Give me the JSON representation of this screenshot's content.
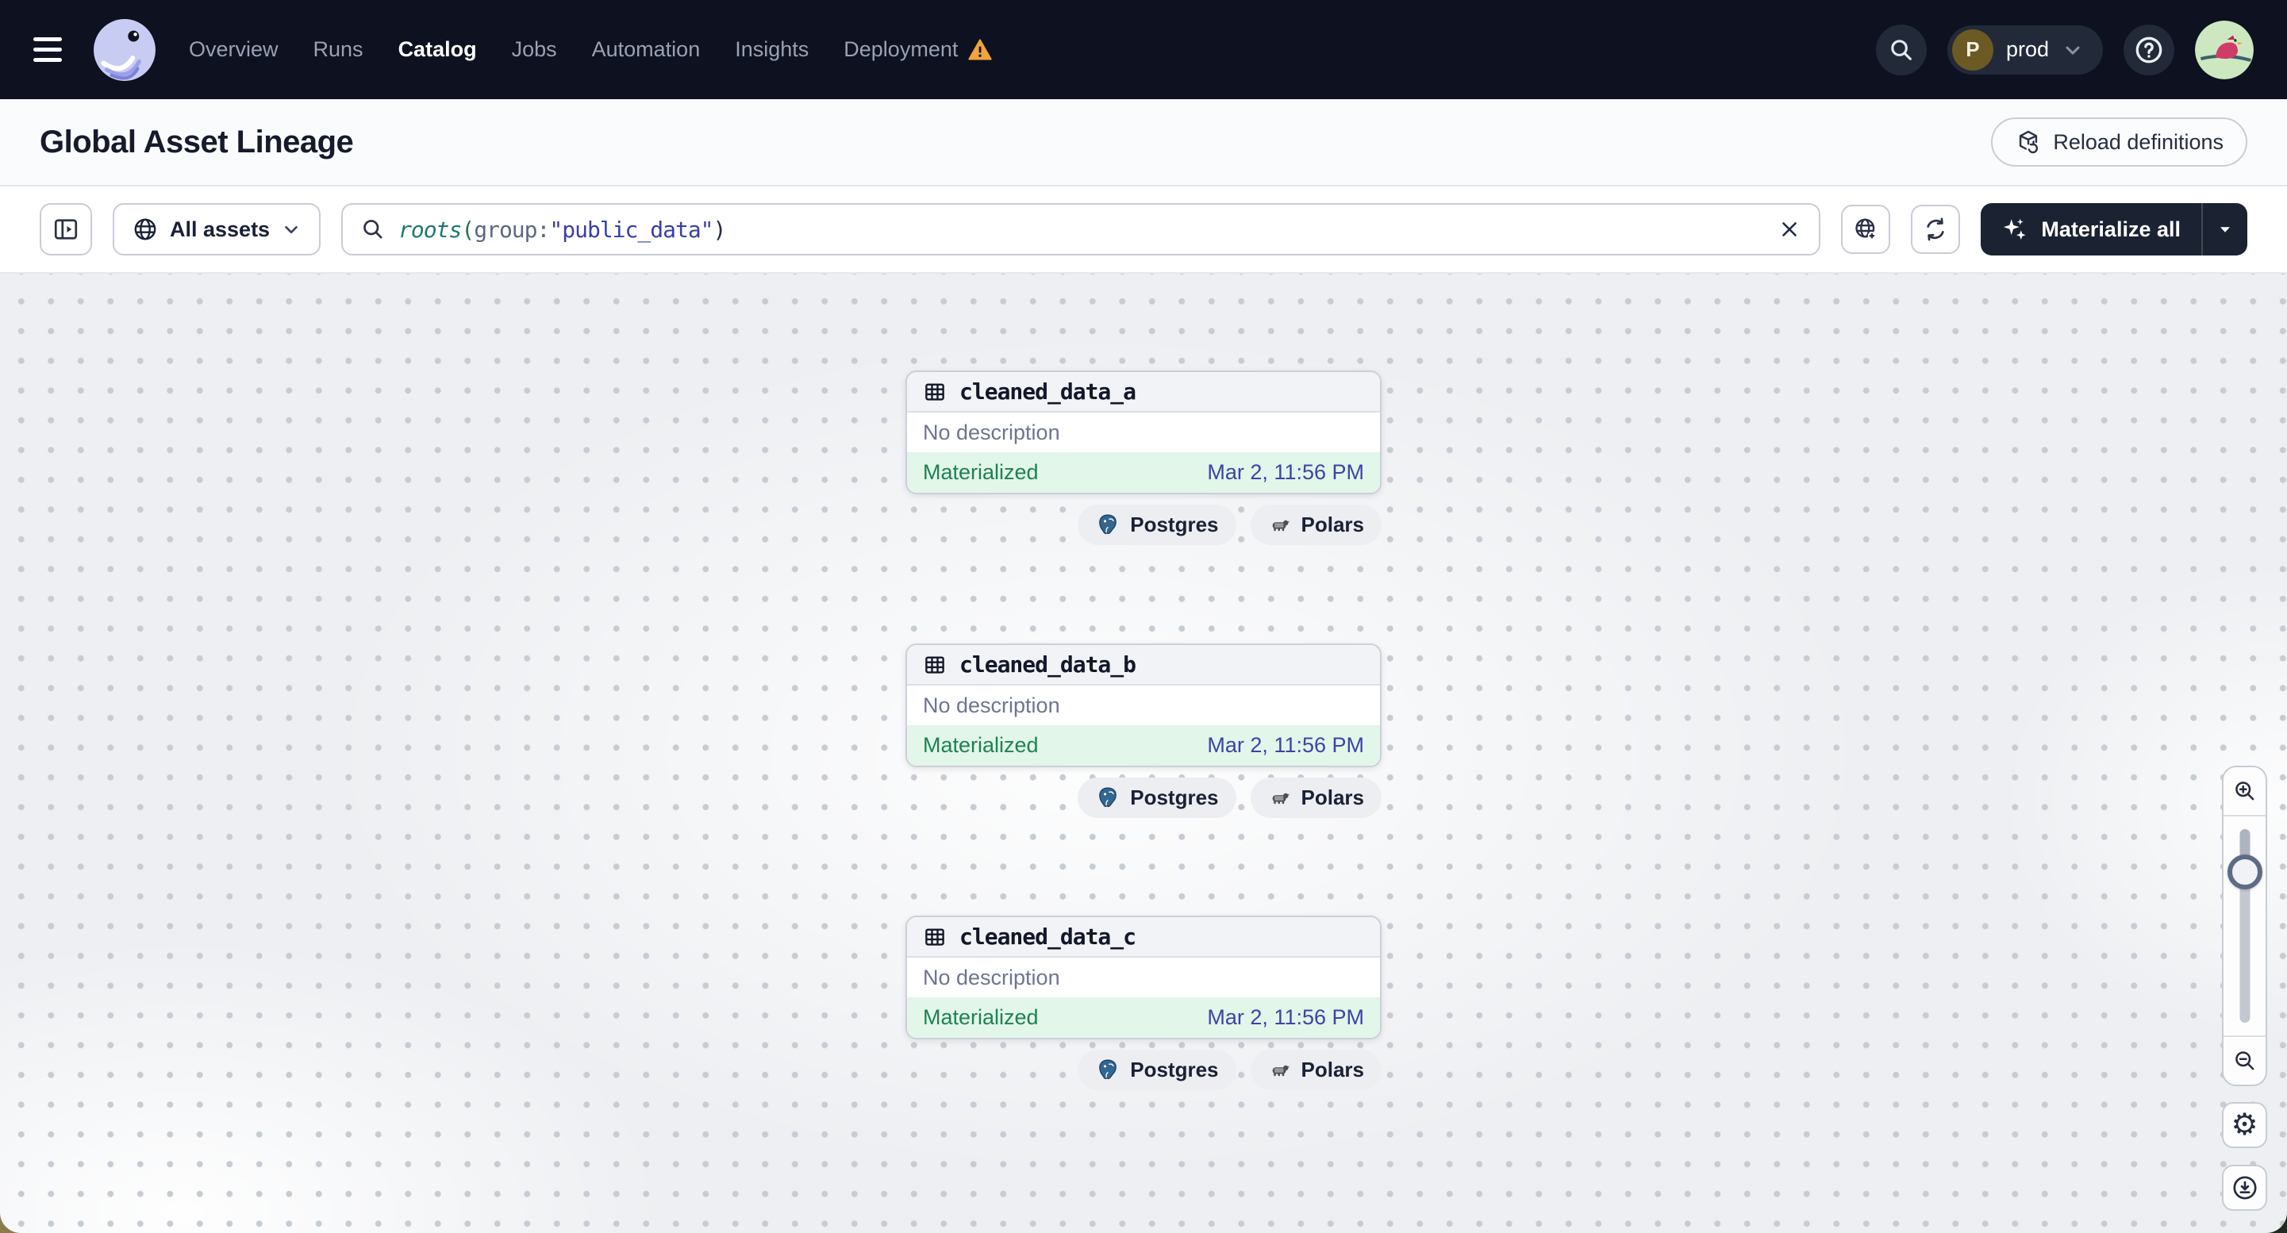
{
  "nav": {
    "items": [
      {
        "label": "Overview"
      },
      {
        "label": "Runs"
      },
      {
        "label": "Catalog"
      },
      {
        "label": "Jobs"
      },
      {
        "label": "Automation"
      },
      {
        "label": "Insights"
      },
      {
        "label": "Deployment"
      }
    ],
    "active_item": "Catalog",
    "workspace": {
      "initial": "P",
      "label": "prod"
    }
  },
  "header": {
    "title": "Global Asset Lineage",
    "reload_label": "Reload definitions"
  },
  "toolbar": {
    "scope_label": "All assets",
    "search_query": {
      "func": "roots",
      "open_paren": "(",
      "key": "group",
      "colon": ":",
      "value": "\"public_data\"",
      "close_paren": ")"
    },
    "materialize_label": "Materialize all"
  },
  "canvas": {
    "assets": [
      {
        "name": "cleaned_data_a",
        "description": "No description",
        "status": "Materialized",
        "timestamp": "Mar 2, 11:56 PM",
        "tags": [
          "Postgres",
          "Polars"
        ]
      },
      {
        "name": "cleaned_data_b",
        "description": "No description",
        "status": "Materialized",
        "timestamp": "Mar 2, 11:56 PM",
        "tags": [
          "Postgres",
          "Polars"
        ]
      },
      {
        "name": "cleaned_data_c",
        "description": "No description",
        "status": "Materialized",
        "timestamp": "Mar 2, 11:56 PM",
        "tags": [
          "Postgres",
          "Polars"
        ]
      }
    ]
  },
  "colors": {
    "nav_bg": "#0d1120",
    "materialized_green": "#1e8250",
    "materialized_bg": "#e2f6ea",
    "timestamp_indigo": "#3e43a8",
    "warning_amber": "#f2a33c",
    "query_func_teal": "#20786e",
    "query_string_indigo": "#3a3fa6",
    "postgres_blue": "#336791"
  }
}
